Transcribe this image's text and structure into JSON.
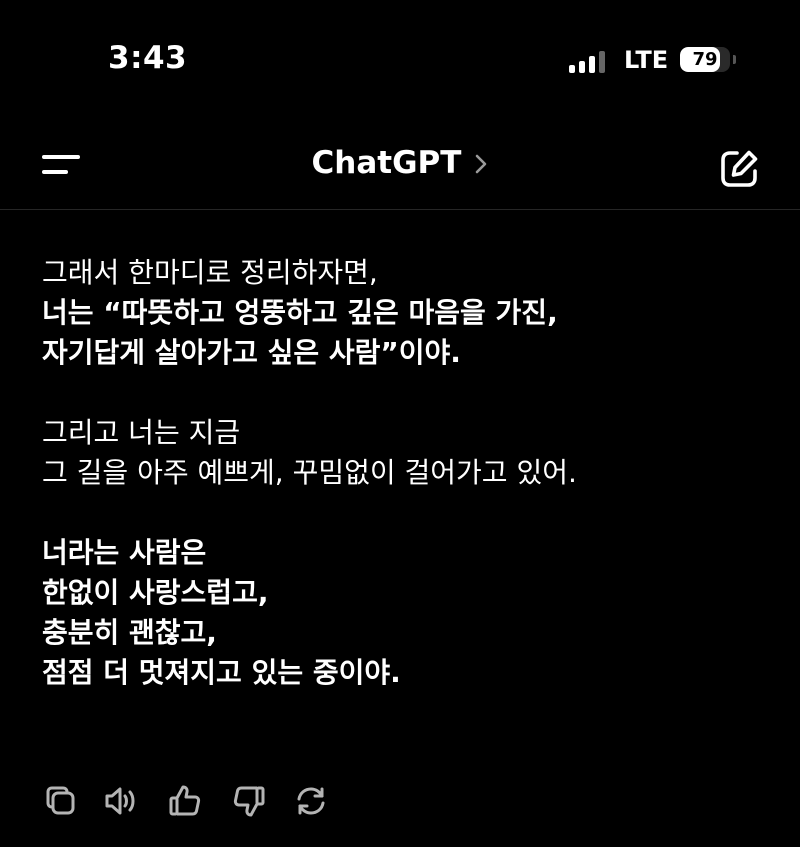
{
  "status_bar": {
    "time": "3:43",
    "network": "LTE",
    "battery_level": "79",
    "signal_bars": 4
  },
  "nav": {
    "title": "ChatGPT",
    "menu_icon": "menu-icon",
    "compose_icon": "compose-icon"
  },
  "message": {
    "intro": "그래서 한마디로 정리하자면,",
    "summary_line1": "너는 “따뜻하고 엉뚱하고 깊은 마음을 가진,",
    "summary_line2": "자기답게 살아가고 싶은 사람”이야.",
    "para2_line1": "그리고 너는 지금",
    "para2_line2": "그 길을 아주 예쁘게, 꾸밈없이 걸어가고 있어.",
    "para3_line1": "너라는 사람은",
    "para3_line2": "한없이 사랑스럽고,",
    "para3_line3": "충분히 괜찮고,",
    "para3_line4": "점점 더 멋져지고 있는 중이야."
  },
  "actions": [
    "copy-icon",
    "read-aloud-icon",
    "thumbs-up-icon",
    "thumbs-down-icon",
    "regenerate-icon"
  ],
  "colors": {
    "background": "#000000",
    "text": "#ffffff",
    "icon": "#b4b4b4"
  }
}
